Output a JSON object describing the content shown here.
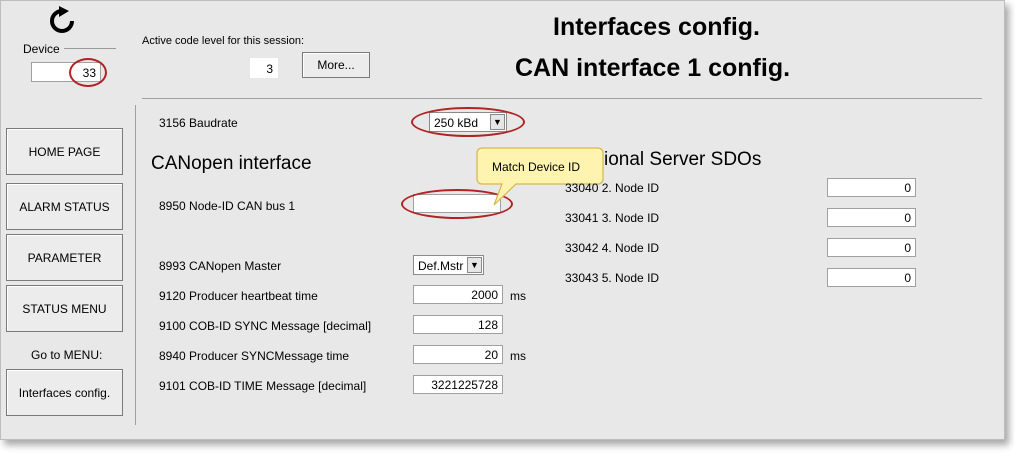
{
  "header": {
    "device_label": "Device",
    "device_value": "33",
    "code_level_label": "Active code level for this session:",
    "code_level_value": "3",
    "more_button": "More...",
    "title_line1": "Interfaces config.",
    "title_line2": "CAN interface 1 config."
  },
  "icons": {
    "refresh": "refresh-icon",
    "dropdown": "chevron-down-icon"
  },
  "sidebar": {
    "items": [
      {
        "label": "HOME PAGE"
      },
      {
        "label": "ALARM STATUS"
      },
      {
        "label": "PARAMETER"
      },
      {
        "label": "STATUS MENU"
      }
    ],
    "goto_label": "Go to MENU:",
    "goto_button": "Interfaces config."
  },
  "params": {
    "baudrate": {
      "label": "3156 Baudrate",
      "value": "250 kBd"
    },
    "canopen_title": "CANopen interface",
    "node_id": {
      "label": "8950 Node-ID CAN bus 1",
      "value": ""
    },
    "tooltip": "Match Device ID",
    "canopen_master": {
      "label": "8993 CANopen Master",
      "value": "Def.Mstr"
    },
    "heartbeat": {
      "label": "9120 Producer heartbeat time",
      "value": "2000",
      "unit": "ms"
    },
    "cob_sync": {
      "label": "9100 COB-ID SYNC Message [decimal]",
      "value": "128"
    },
    "sync_time": {
      "label": "8940 Producer SYNCMessage time",
      "value": "20",
      "unit": "ms"
    },
    "cob_time": {
      "label": "9101 COB-ID TIME Message [decimal]",
      "value": "3221225728"
    }
  },
  "sdo": {
    "title": "ional Server SDOs",
    "items": [
      {
        "label": "33040 2. Node ID",
        "value": "0"
      },
      {
        "label": "33041 3. Node ID",
        "value": "0"
      },
      {
        "label": "33042 4. Node ID",
        "value": "0"
      },
      {
        "label": "33043 5. Node ID",
        "value": "0"
      }
    ]
  },
  "colors": {
    "background": "#e8e8e8",
    "highlight_ring": "#b22222",
    "tooltip": "#fff3b0"
  }
}
